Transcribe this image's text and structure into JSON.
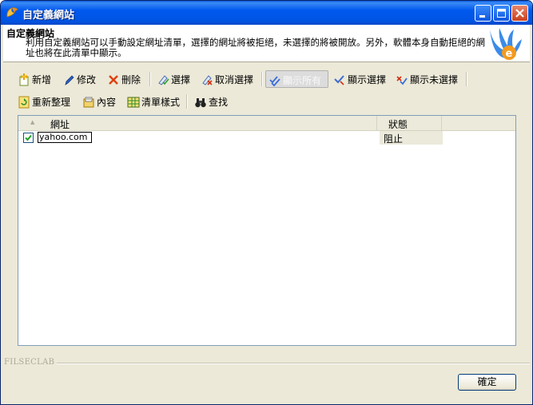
{
  "window": {
    "title": "自定義網站"
  },
  "header": {
    "title": "自定義網站",
    "description": "利用自定義網站可以手動設定網址清單，選擇的網址將被拒絕，未選擇的將被開放。另外，軟體本身自動拒絕的網址也將在此清單中顯示。"
  },
  "toolbar1": {
    "add": "新增",
    "edit": "修改",
    "delete": "刪除",
    "select": "選擇",
    "deselect": "取消選擇",
    "show_all": "顯示所有",
    "show_selected": "顯示選擇",
    "show_unselected": "顯示未選擇"
  },
  "toolbar2": {
    "refresh": "重新整理",
    "content": "內容",
    "list_style": "清單樣式",
    "find": "查找"
  },
  "list": {
    "columns": {
      "url": "網址",
      "status": "狀態",
      "sort_indicator": "▲"
    },
    "rows": [
      {
        "url": "yahoo.com",
        "status": "阻止",
        "checked": true
      }
    ]
  },
  "footer": {
    "label": "FILSECLAB",
    "ok": "確定"
  },
  "colors": {
    "title_bar": "#0054e3",
    "dialog_bg": "#ece9d8",
    "close_button": "#c9411f"
  }
}
